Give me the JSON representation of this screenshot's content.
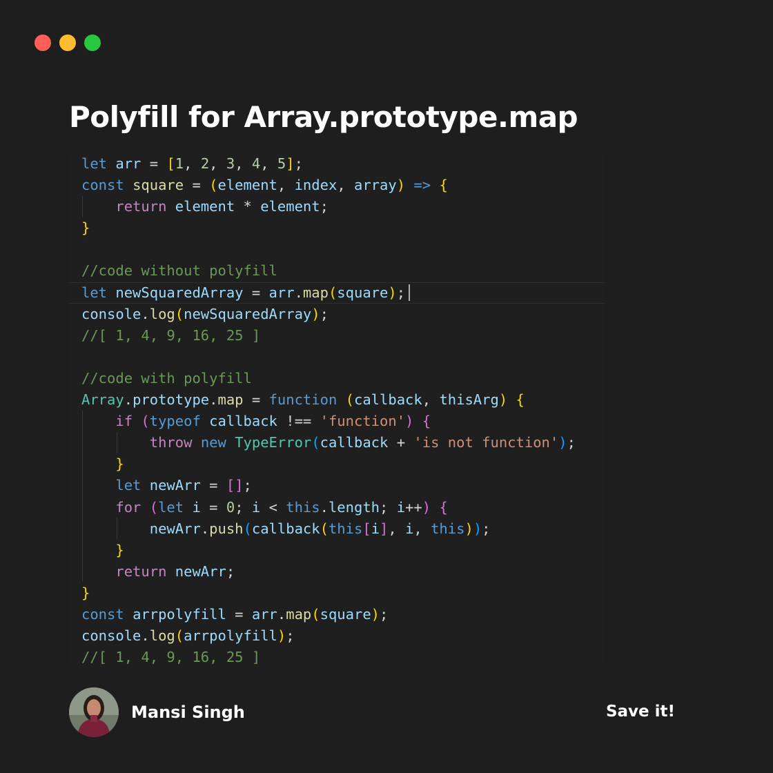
{
  "title": "Polyfill for Array.prototype.map",
  "window_controls": {
    "close_color": "#ff5f57",
    "minimize_color": "#febc2e",
    "maximize_color": "#28c840"
  },
  "code_lines": [
    "let arr = [1, 2, 3, 4, 5];",
    "const square = (element, index, array) => {",
    "    return element * element;",
    "}",
    "",
    "//code without polyfill",
    "let newSquaredArray = arr.map(square);",
    "console.log(newSquaredArray);",
    "//[ 1, 4, 9, 16, 25 ]",
    "",
    "//code with polyfill",
    "Array.prototype.map = function (callback, thisArg) {",
    "    if (typeof callback !== 'function') {",
    "        throw new TypeError(callback + 'is not function');",
    "    }",
    "    let newArr = [];",
    "    for (let i = 0; i < this.length; i++) {",
    "        newArr.push(callback(this[i], i, this));",
    "    }",
    "    return newArr;",
    "}",
    "const arrpolyfill = arr.map(square);",
    "console.log(arrpolyfill);",
    "//[ 1, 4, 9, 16, 25 ]"
  ],
  "author": {
    "name": "Mansi Singh",
    "avatar_icon": "person-photo"
  },
  "cta": "Save it!",
  "colors": {
    "background": "#1e1e1e",
    "keyword": "#569cd6",
    "control": "#c586c0",
    "variable": "#9cdcfe",
    "function": "#dcdcaa",
    "number": "#b5cea8",
    "string": "#ce9178",
    "comment": "#6a9955",
    "class": "#4ec9b0"
  }
}
